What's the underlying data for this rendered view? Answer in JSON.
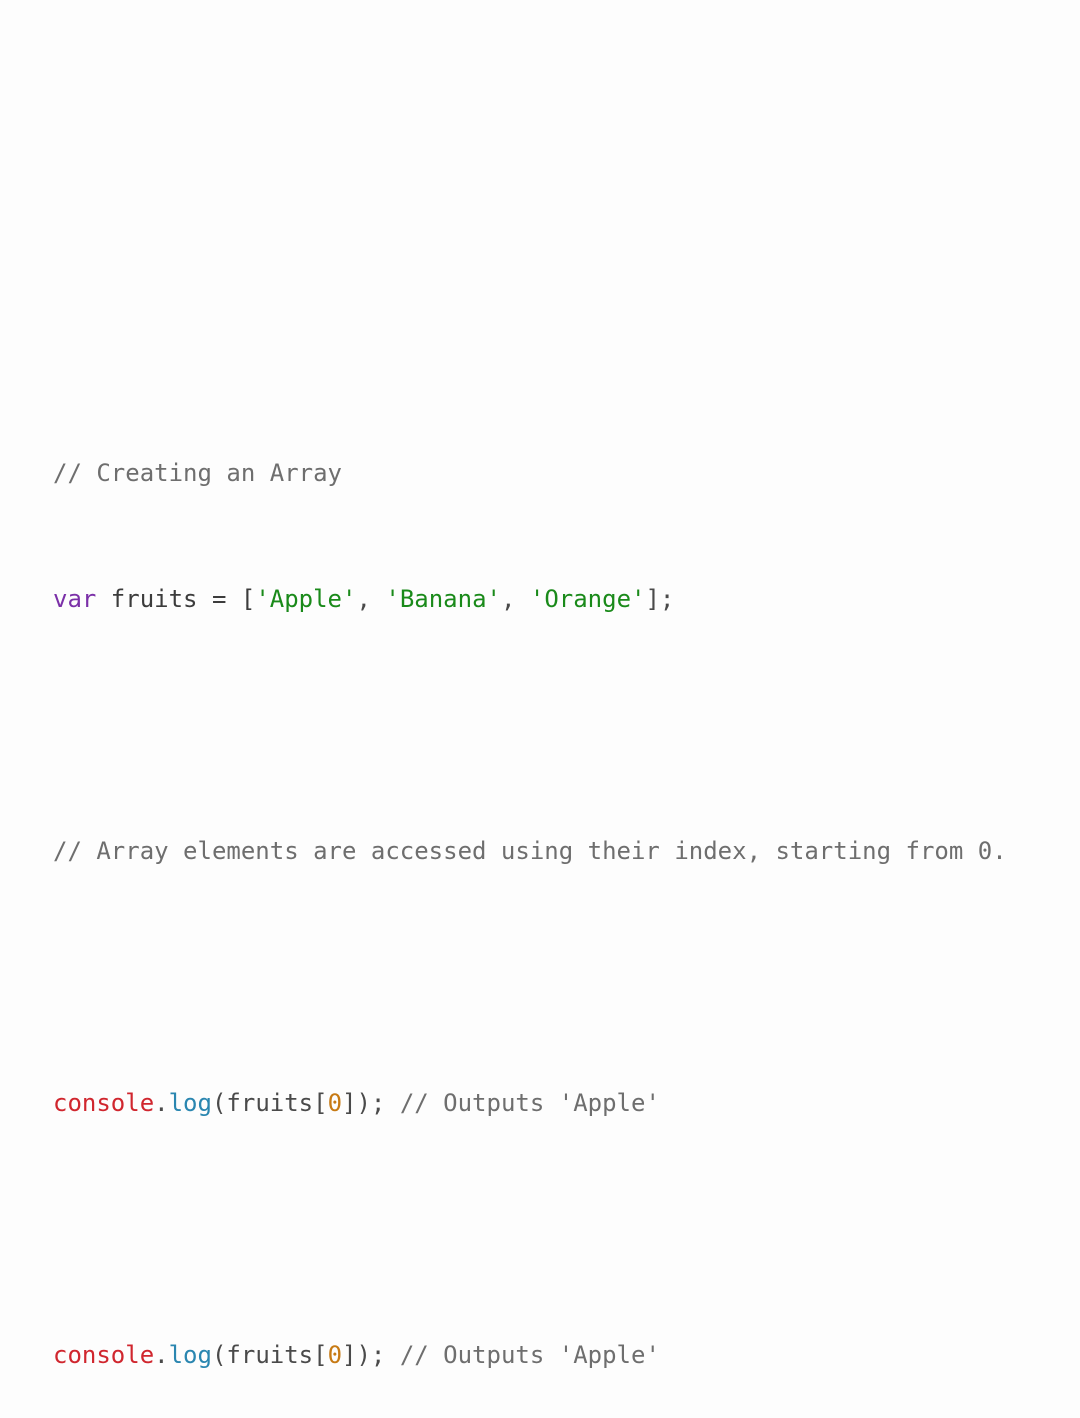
{
  "colors": {
    "background": "#fdfdfd",
    "comment": "#6e6e6e",
    "keyword": "#7b30a8",
    "string": "#1a8a1a",
    "object": "#d0262e",
    "method": "#2a86b0",
    "number": "#c77a14",
    "default": "#3c3c3c"
  },
  "code": {
    "line1": {
      "comment": "// Creating an Array"
    },
    "line2": {
      "keyword": "var",
      "rest_a": " fruits = [",
      "str1": "'Apple'",
      "sep1": ", ",
      "str2": "'Banana'",
      "sep2": ", ",
      "str3": "'Orange'",
      "end": "];"
    },
    "line4": {
      "comment": "// Array elements are accessed using their index, starting from 0."
    },
    "line6": {
      "object": "console",
      "dot": ".",
      "method": "log",
      "open": "(fruits[",
      "number": "0",
      "close": "]); ",
      "comment": "// Outputs 'Apple'"
    },
    "line8": {
      "object": "console",
      "dot": ".",
      "method": "log",
      "open": "(fruits[",
      "number": "0",
      "close": "]); ",
      "comment": "// Outputs 'Apple'"
    }
  }
}
